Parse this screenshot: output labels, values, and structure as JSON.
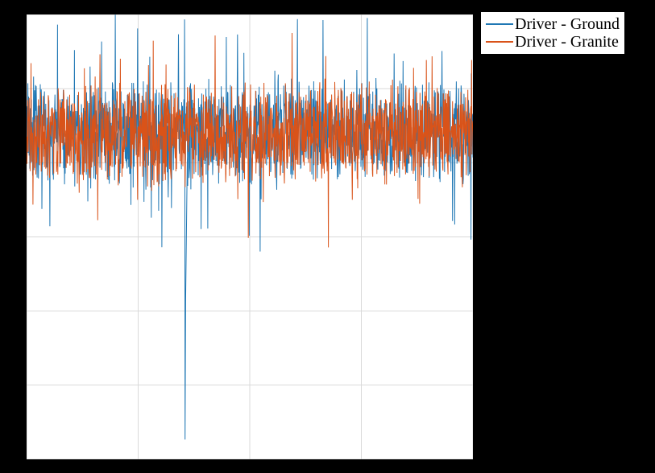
{
  "chart_data": {
    "type": "line",
    "title": "",
    "xlabel": "",
    "ylabel": "",
    "xlim": [
      0,
      4
    ],
    "ylim": [
      -60,
      30
    ],
    "grid": true,
    "legend_position": "outside-right-top",
    "x_gridlines": [
      0,
      1,
      2,
      3,
      4
    ],
    "y_gridlines": [
      -60,
      -45,
      -30,
      -15,
      0,
      15,
      30
    ],
    "series": [
      {
        "name": "Driver - Ground",
        "color": "#1f77b4",
        "band_center": 6,
        "band_amplitude": 15,
        "spike": {
          "x": 1.42,
          "low": -56,
          "high": 29
        }
      },
      {
        "name": "Driver - Granite",
        "color": "#d95319",
        "band_center": 6,
        "band_amplitude": 14,
        "spike": null
      }
    ]
  },
  "legend": {
    "items": [
      "Driver - Ground",
      "Driver - Granite"
    ]
  }
}
